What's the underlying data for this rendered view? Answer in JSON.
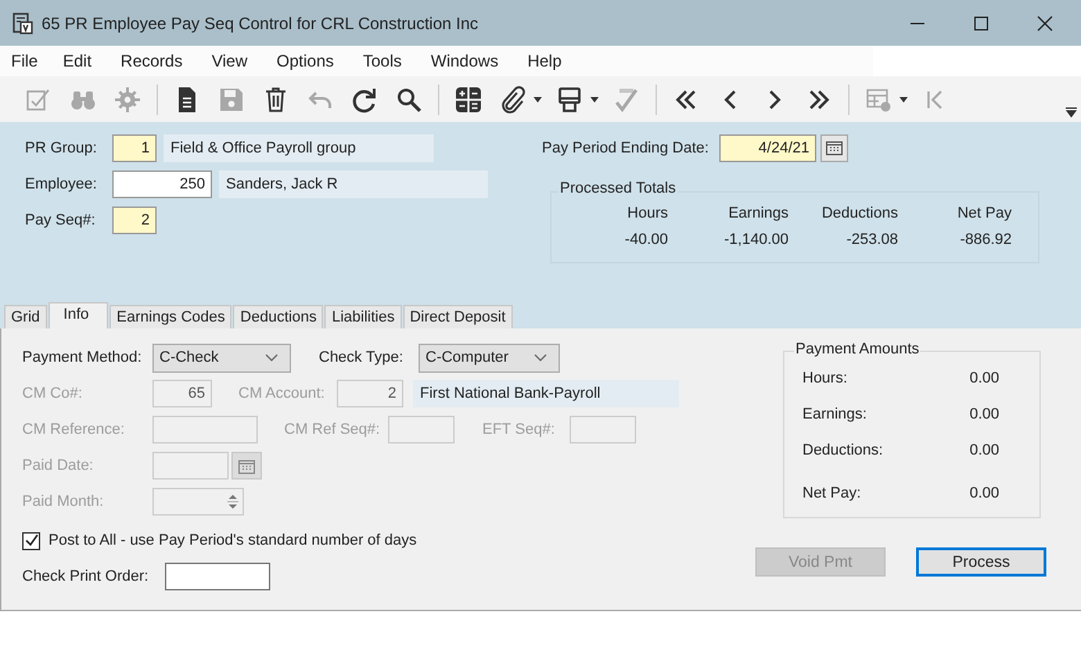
{
  "window": {
    "title": "65 PR Employee Pay Seq Control for CRL Construction Inc"
  },
  "menu": [
    "File",
    "Edit",
    "Records",
    "View",
    "Options",
    "Tools",
    "Windows",
    "Help"
  ],
  "toolbar": [
    {
      "kind": "checklist",
      "disabled": true
    },
    {
      "kind": "binoculars",
      "disabled": true
    },
    {
      "kind": "gear",
      "disabled": true
    },
    {
      "kind": "separator"
    },
    {
      "kind": "document",
      "disabled": false
    },
    {
      "kind": "floppy",
      "disabled": true
    },
    {
      "kind": "trash",
      "disabled": false
    },
    {
      "kind": "undo",
      "disabled": true
    },
    {
      "kind": "refresh",
      "disabled": false
    },
    {
      "kind": "search",
      "disabled": false
    },
    {
      "kind": "separator"
    },
    {
      "kind": "calculator",
      "disabled": false
    },
    {
      "kind": "paperclip",
      "disabled": false,
      "dropdown": true
    },
    {
      "kind": "printer",
      "disabled": false,
      "dropdown": true
    },
    {
      "kind": "spellcheck",
      "disabled": true
    },
    {
      "kind": "separator"
    },
    {
      "kind": "first",
      "disabled": false
    },
    {
      "kind": "prev",
      "disabled": false
    },
    {
      "kind": "next",
      "disabled": false
    },
    {
      "kind": "last",
      "disabled": false
    },
    {
      "kind": "separator"
    },
    {
      "kind": "tablegear",
      "disabled": true,
      "dropdown": true
    },
    {
      "kind": "skipstart",
      "disabled": true
    }
  ],
  "header": {
    "pr_group": {
      "label": "PR Group:",
      "value": "1",
      "description": "Field & Office Payroll group"
    },
    "employee": {
      "label": "Employee:",
      "value": "250",
      "description": "Sanders, Jack R"
    },
    "pay_seq": {
      "label": "Pay Seq#:",
      "value": "2"
    },
    "pay_period": {
      "label": "Pay Period Ending Date:",
      "value": "4/24/21"
    },
    "processed_totals": {
      "title": "Processed Totals",
      "columns": [
        {
          "label": "Hours",
          "value": "-40.00"
        },
        {
          "label": "Earnings",
          "value": "-1,140.00"
        },
        {
          "label": "Deductions",
          "value": "-253.08"
        },
        {
          "label": "Net Pay",
          "value": "-886.92"
        }
      ]
    }
  },
  "tabs": [
    {
      "label": "Grid",
      "selected": false
    },
    {
      "label": "Info",
      "selected": true
    },
    {
      "label": "Earnings Codes",
      "selected": false
    },
    {
      "label": "Deductions",
      "selected": false
    },
    {
      "label": "Liabilities",
      "selected": false
    },
    {
      "label": "Direct Deposit",
      "selected": false
    }
  ],
  "info": {
    "payment_method": {
      "label": "Payment Method:",
      "value": "C-Check"
    },
    "check_type": {
      "label": "Check Type:",
      "value": "C-Computer"
    },
    "cm_co": {
      "label": "CM Co#:",
      "value": "65",
      "disabled": true
    },
    "cm_account": {
      "label": "CM Account:",
      "value": "2",
      "description": "First National Bank-Payroll",
      "disabled": true
    },
    "cm_reference": {
      "label": "CM Reference:",
      "disabled": true
    },
    "cm_ref_seq": {
      "label": "CM Ref Seq#:",
      "disabled": true
    },
    "eft_seq": {
      "label": "EFT Seq#:",
      "disabled": true
    },
    "paid_date": {
      "label": "Paid Date:",
      "disabled": true
    },
    "paid_month": {
      "label": "Paid Month:",
      "disabled": true
    },
    "post_to_all": {
      "label": "Post to All - use Pay Period's standard number of days",
      "checked": true
    },
    "check_print_order": {
      "label": "Check Print Order:"
    }
  },
  "payment_amounts": {
    "title": "Payment Amounts",
    "rows": [
      {
        "label": "Hours:",
        "value": "0.00"
      },
      {
        "label": "Earnings:",
        "value": "0.00"
      },
      {
        "label": "Deductions:",
        "value": "0.00"
      },
      {
        "label": "Net Pay:",
        "value": "0.00"
      }
    ]
  },
  "buttons": [
    {
      "label": "Void Pmt",
      "disabled": true,
      "focused": false
    },
    {
      "label": "Process",
      "disabled": false,
      "focused": true
    }
  ]
}
